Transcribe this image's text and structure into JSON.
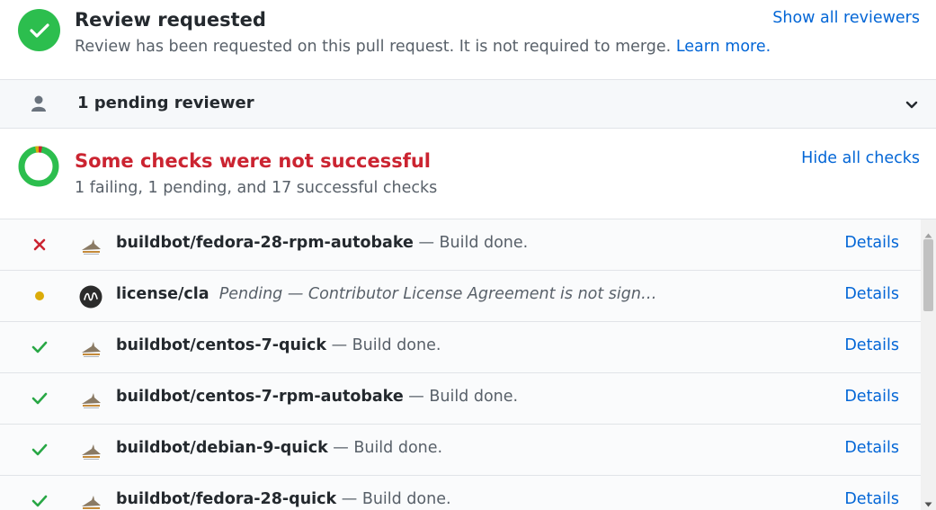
{
  "review": {
    "title": "Review requested",
    "description": "Review has been requested on this pull request. It is not required to merge.",
    "learn_more": "Learn more.",
    "show_all_reviewers": "Show all reviewers"
  },
  "pending": {
    "label": "1 pending reviewer"
  },
  "checks": {
    "title": "Some checks were not successful",
    "summary": "1 failing, 1 pending, and 17 successful checks",
    "hide_all": "Hide all checks",
    "details_label": "Details",
    "rows": [
      {
        "status": "failure",
        "avatar": "buildbot-icon",
        "name": "buildbot/fedora-28-rpm-autobake",
        "description": "— Build done."
      },
      {
        "status": "pending",
        "avatar": "cla-icon",
        "name": "license/cla",
        "description": "Pending — Contributor License Agreement is not sign…"
      },
      {
        "status": "success",
        "avatar": "buildbot-icon",
        "name": "buildbot/centos-7-quick",
        "description": "— Build done."
      },
      {
        "status": "success",
        "avatar": "buildbot-icon",
        "name": "buildbot/centos-7-rpm-autobake",
        "description": "— Build done."
      },
      {
        "status": "success",
        "avatar": "buildbot-icon",
        "name": "buildbot/debian-9-quick",
        "description": "— Build done."
      },
      {
        "status": "success",
        "avatar": "buildbot-icon",
        "name": "buildbot/fedora-28-quick",
        "description": "— Build done."
      }
    ]
  },
  "colors": {
    "success": "#2cbe4e",
    "failure": "#cb2431",
    "pending": "#dbab09",
    "link": "#0366d6"
  }
}
